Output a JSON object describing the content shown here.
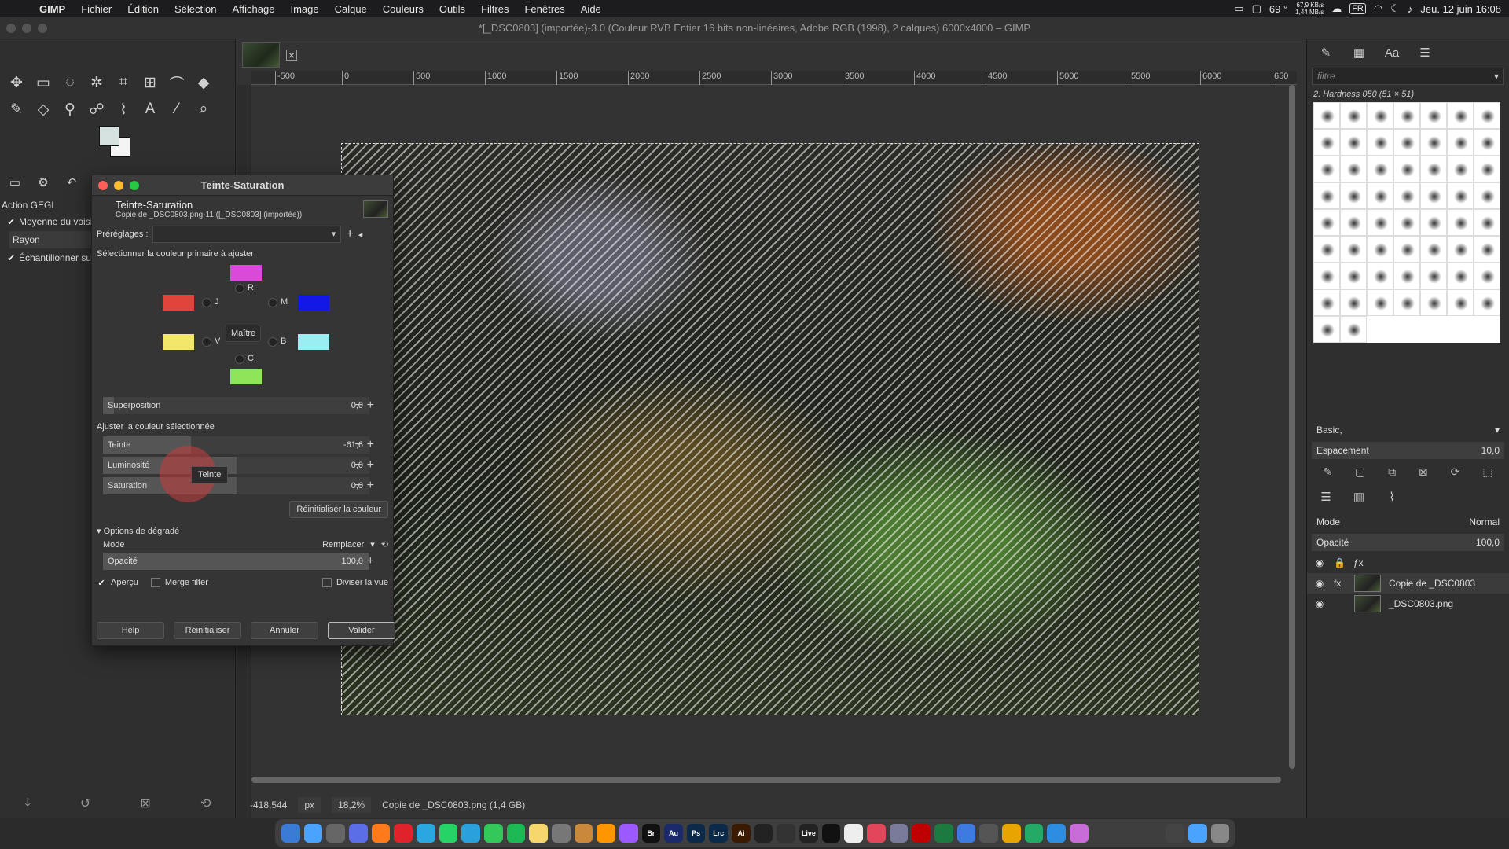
{
  "menubar": {
    "app_name": "GIMP",
    "items": [
      "Fichier",
      "Édition",
      "Sélection",
      "Affichage",
      "Image",
      "Calque",
      "Couleurs",
      "Outils",
      "Filtres",
      "Fenêtres",
      "Aide"
    ],
    "temp": "69 °",
    "net_up": "67,9 KB/s",
    "net_down": "1,44 MB/s",
    "lang": "FR",
    "datetime": "Jeu. 12 juin  16:08"
  },
  "window": {
    "title": "*[_DSC0803] (importée)-3.0 (Couleur RVB Entier 16 bits non-linéaires, Adobe RGB (1998), 2 calques) 6000x4000 – GIMP"
  },
  "tool_options": {
    "title": "Action GEGL",
    "opt1": "Moyenne du voisinage",
    "opt2_label": "Rayon",
    "opt3": "Échantillonner sur tout"
  },
  "ruler": {
    "ticks": [
      "-500",
      "0",
      "500",
      "1000",
      "1500",
      "2000",
      "2500",
      "3000",
      "3500",
      "4000",
      "4500",
      "5000",
      "5500",
      "6000",
      "650"
    ]
  },
  "dialog": {
    "window_title": "Teinte-Saturation",
    "heading": "Teinte-Saturation",
    "subheading": "Copie de _DSC0803.png-11 ([_DSC0803] (importée))",
    "presets_label": "Préréglages :",
    "primary_label": "Sélectionner la couleur primaire à ajuster",
    "radios": {
      "R": "R",
      "J": "J",
      "M": "M",
      "V": "V",
      "B": "B",
      "C": "C"
    },
    "master_label": "Maître",
    "colors": {
      "R": "#d94ad9",
      "J": "#e0443b",
      "M": "#1418e6",
      "V": "#f2e66b",
      "B": "#99eef2",
      "C": "#8fe55a"
    },
    "overlap_label": "Superposition",
    "overlap_value": "0,0",
    "adjust_label": "Ajuster la couleur sélectionnée",
    "hue_label": "Teinte",
    "hue_value": "-61,6",
    "lum_label": "Luminosité",
    "lum_value": "0,0",
    "sat_label": "Saturation",
    "sat_value": "0,0",
    "reset_color": "Réinitialiser la couleur",
    "blend_section": "Options de dégradé",
    "mode_label": "Mode",
    "mode_value": "Remplacer",
    "opacity_label": "Opacité",
    "opacity_value": "100,0",
    "preview_label": "Aperçu",
    "merge_label": "Merge filter",
    "split_label": "Diviser la vue",
    "buttons": {
      "help": "Help",
      "reset": "Réinitialiser",
      "cancel": "Annuler",
      "ok": "Valider"
    },
    "tooltip": "Teinte"
  },
  "status": {
    "coords": "-418,544",
    "unit": "px",
    "zoom": "18,2%",
    "info": "Copie de _DSC0803.png (1,4 GB)"
  },
  "right_dock": {
    "filter_placeholder": "filtre",
    "brush_name": "2. Hardness 050 (51 × 51)",
    "preset": "Basic,",
    "spacing_label": "Espacement",
    "spacing_value": "10,0",
    "mode_label": "Mode",
    "mode_value": "Normal",
    "opacity_label": "Opacité",
    "opacity_value": "100,0",
    "layers": [
      {
        "name": "Copie de _DSC0803",
        "fx": "fx"
      },
      {
        "name": "_DSC0803.png",
        "fx": ""
      }
    ]
  },
  "dock_apps": [
    "Br",
    "Au",
    "Ps",
    "Lrc",
    "Ai",
    "Live"
  ]
}
